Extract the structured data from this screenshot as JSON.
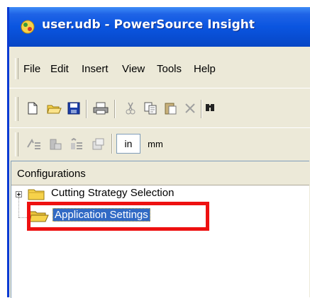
{
  "window": {
    "title": "user.udb - PowerSource Insight"
  },
  "menu": {
    "items": [
      "File",
      "Edit",
      "Insert",
      "View",
      "Tools",
      "Help"
    ]
  },
  "toolbar1": {
    "buttons": [
      "new-icon",
      "open-icon",
      "save-icon",
      "print-icon",
      "cut-icon",
      "copy-icon",
      "paste-icon",
      "delete-icon",
      "find-icon"
    ]
  },
  "toolbar2": {
    "buttons": [
      "add-config-icon",
      "add-folder-icon",
      "add-item-icon",
      "properties-icon"
    ],
    "unit_in": "in",
    "unit_mm": "mm"
  },
  "panel": {
    "header": "Configurations"
  },
  "tree": {
    "items": [
      {
        "label": "Cutting Strategy Selection",
        "expanded": false,
        "selected": false
      },
      {
        "label": "Application Settings",
        "expanded": true,
        "selected": true
      }
    ]
  },
  "colors": {
    "title_bar": "#0a55e0",
    "highlight": "#ee1111",
    "selection": "#316ac5",
    "folder": "#f6d24a"
  }
}
